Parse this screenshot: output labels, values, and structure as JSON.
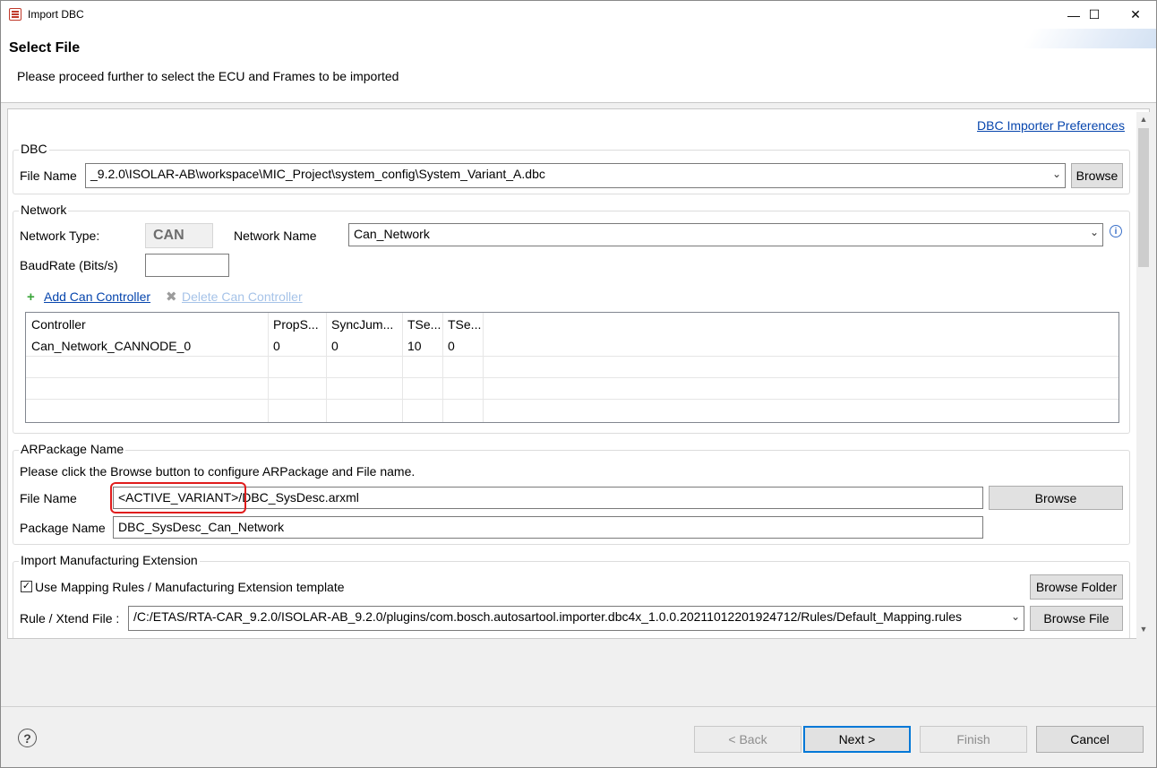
{
  "window": {
    "title": "Import DBC",
    "minimize": "—",
    "maximize": "☐",
    "close": "✕"
  },
  "header": {
    "title": "Select File",
    "message": "Please proceed further to select the ECU and Frames to be imported"
  },
  "preferences_link": "DBC Importer Preferences",
  "dbc": {
    "group_label": "DBC",
    "file_name_label": "File Name",
    "file_name_value": "_9.2.0\\ISOLAR-AB\\workspace\\MIC_Project\\system_config\\System_Variant_A.dbc",
    "browse_label": "Browse"
  },
  "network": {
    "group_label": "Network",
    "type_label": "Network Type:",
    "type_value": "CAN",
    "name_label": "Network Name",
    "name_value": "Can_Network",
    "baudrate_label": "BaudRate (Bits/s)",
    "baudrate_value": "",
    "add_controller": "Add Can Controller",
    "delete_controller": "Delete Can Controller",
    "table": {
      "columns": [
        "Controller",
        "PropS...",
        "SyncJum...",
        "TSe...",
        "TSe..."
      ],
      "rows": [
        [
          "Can_Network_CANNODE_0",
          "0",
          "0",
          "10",
          "0"
        ]
      ]
    }
  },
  "arpackage": {
    "group_label": "ARPackage Name",
    "instruction": "Please click the Browse button to configure ARPackage and File name.",
    "file_name_label": "File Name",
    "file_name_value": "<ACTIVE_VARIANT>/DBC_SysDesc.arxml",
    "browse_label": "Browse",
    "package_name_label": "Package Name",
    "package_name_value": "DBC_SysDesc_Can_Network"
  },
  "manufacturing": {
    "group_label": "Import Manufacturing Extension",
    "checkbox_label": "Use Mapping Rules / Manufacturing Extension template",
    "checkbox_checked": true,
    "browse_folder_label": "Browse Folder",
    "rule_label": "Rule / Xtend File :",
    "rule_value": "/C:/ETAS/RTA-CAR_9.2.0/ISOLAR-AB_9.2.0/plugins/com.bosch.autosartool.importer.dbc4x_1.0.0.20211012201924712/Rules/Default_Mapping.rules",
    "browse_file_label": "Browse File"
  },
  "footer": {
    "help": "?",
    "back": "< Back",
    "next": "Next >",
    "finish": "Finish",
    "cancel": "Cancel"
  },
  "colors": {
    "link": "#0645ad",
    "highlight": "#e01c1c",
    "focus": "#0078d7"
  }
}
